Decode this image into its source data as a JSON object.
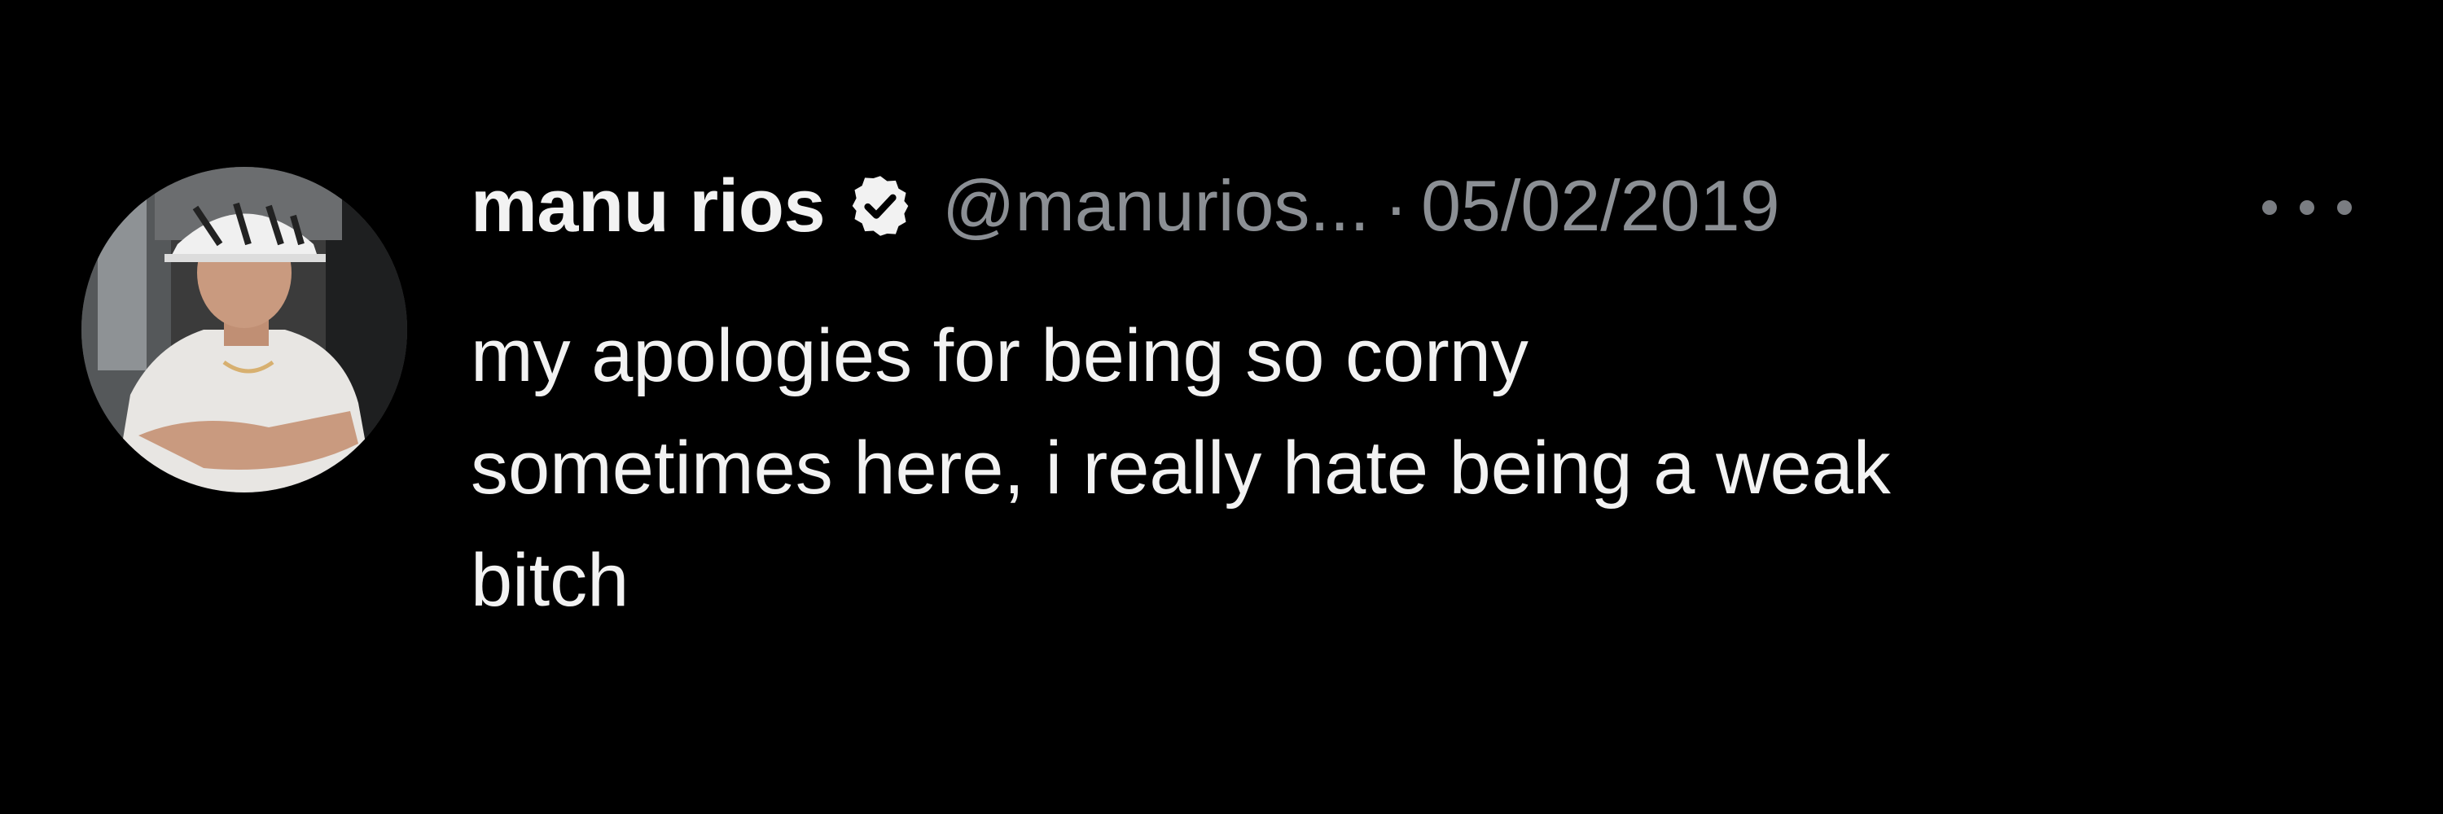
{
  "tweet": {
    "author": {
      "display_name": "manu rios",
      "handle": "@manurios...",
      "verified": true,
      "avatar_icon": "profile-photo"
    },
    "separator": "·",
    "date": "05/02/2019",
    "text": "my apologies for being so corny\nsometimes here, i really hate being a weak\nbitch",
    "more_icon": "ellipsis-icon"
  },
  "colors": {
    "background": "#000000",
    "primary_text": "#f2f2f2",
    "secondary_text": "#8b8f94",
    "verified_badge": "#f2f2f2"
  }
}
